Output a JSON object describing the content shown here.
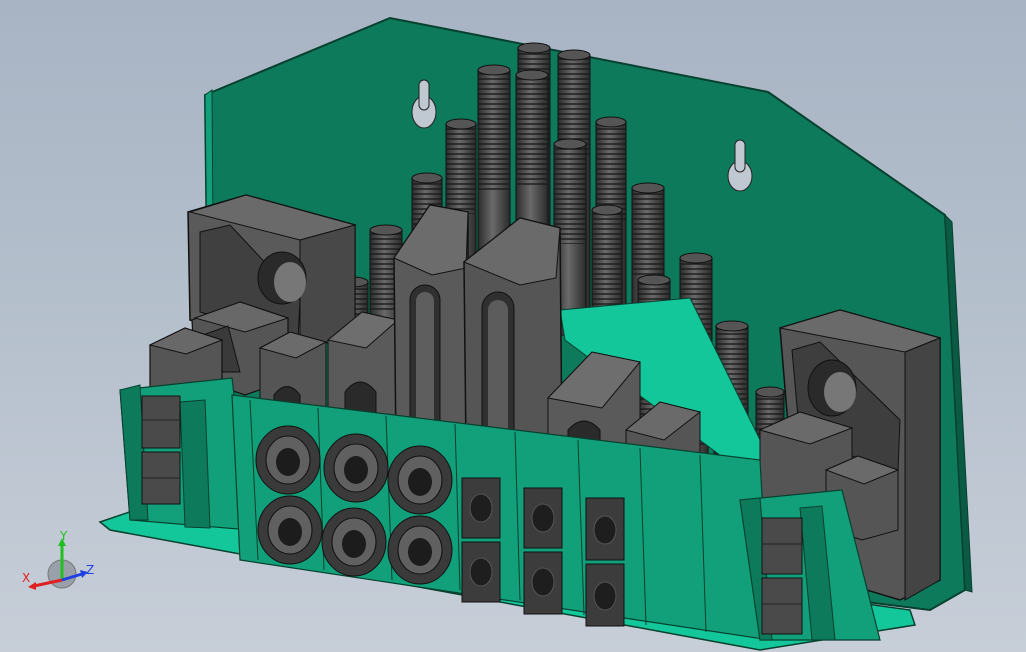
{
  "viewport": {
    "background_top": "#a8b4c4",
    "background_bottom": "#c7ced8"
  },
  "model": {
    "plate_color": "#0e7a5c",
    "plate_edge_color": "#0a5a44",
    "base_color": "#14c79a",
    "part_color": "#555555",
    "part_dark_color": "#333333",
    "part_light_color": "#707070"
  },
  "triad": {
    "x_label": "X",
    "y_label": "Y",
    "z_label": "Z",
    "x_color": "#e02020",
    "y_color": "#20c020",
    "z_color": "#2040e0"
  }
}
